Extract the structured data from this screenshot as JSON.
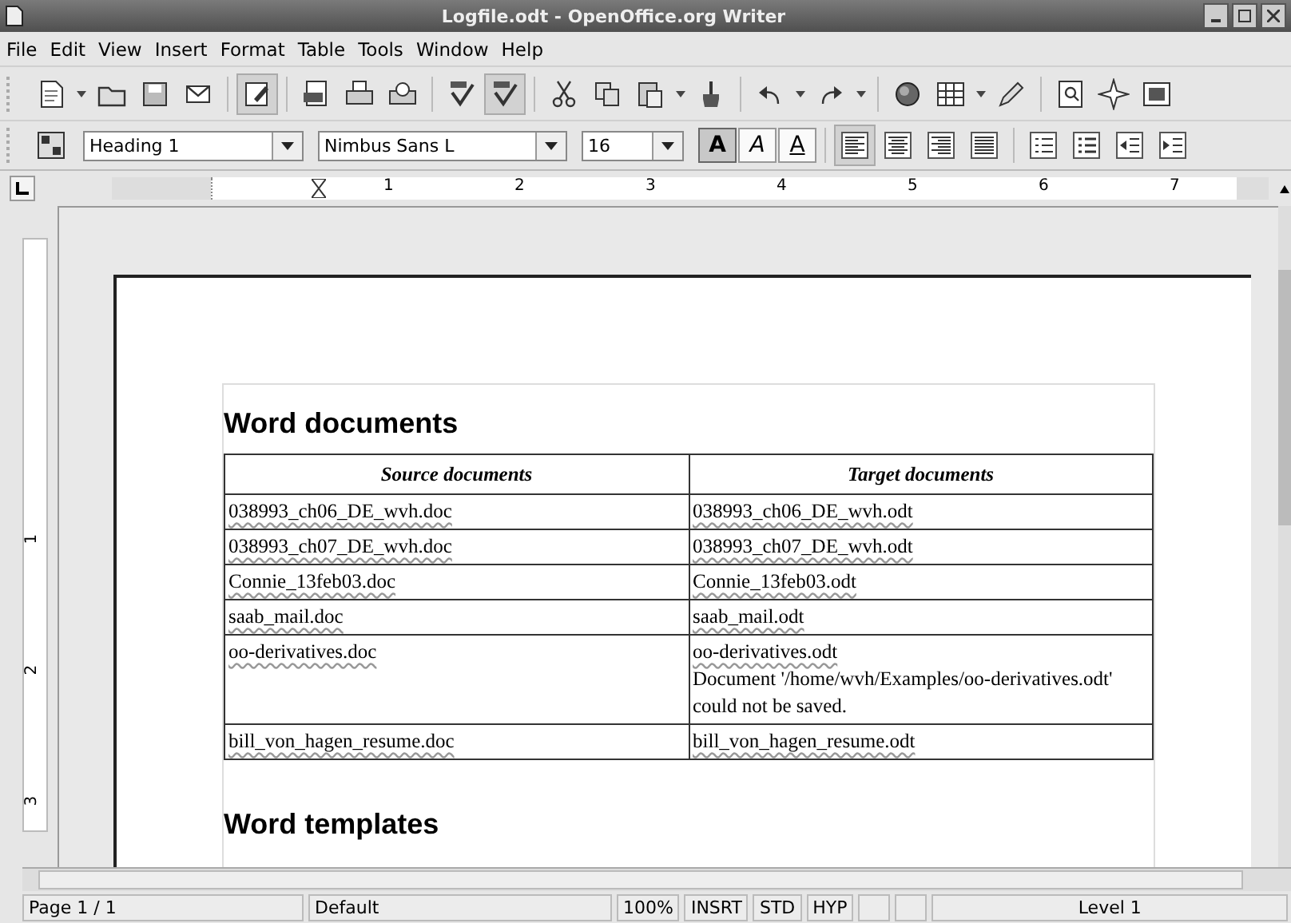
{
  "window": {
    "title": "Logfile.odt - OpenOffice.org Writer"
  },
  "menu": [
    "File",
    "Edit",
    "View",
    "Insert",
    "Format",
    "Table",
    "Tools",
    "Window",
    "Help"
  ],
  "standard_toolbar": [
    {
      "kind": "new",
      "on": false
    },
    {
      "kind": "drop"
    },
    {
      "kind": "open",
      "on": false
    },
    {
      "kind": "save",
      "on": false
    },
    {
      "kind": "mail",
      "on": false
    },
    {
      "kind": "sep"
    },
    {
      "kind": "edit",
      "on": true
    },
    {
      "kind": "sep"
    },
    {
      "kind": "pdf",
      "on": false
    },
    {
      "kind": "print",
      "on": false
    },
    {
      "kind": "preview",
      "on": false
    },
    {
      "kind": "sep"
    },
    {
      "kind": "spell",
      "on": false
    },
    {
      "kind": "spell",
      "on": true
    },
    {
      "kind": "sep"
    },
    {
      "kind": "cut",
      "on": false
    },
    {
      "kind": "copy",
      "on": false
    },
    {
      "kind": "paste",
      "on": false
    },
    {
      "kind": "drop"
    },
    {
      "kind": "brush",
      "on": false
    },
    {
      "kind": "sep"
    },
    {
      "kind": "undo",
      "on": false
    },
    {
      "kind": "drop"
    },
    {
      "kind": "redo",
      "on": false
    },
    {
      "kind": "drop"
    },
    {
      "kind": "sep"
    },
    {
      "kind": "globe",
      "on": false
    },
    {
      "kind": "table",
      "on": false
    },
    {
      "kind": "drop"
    },
    {
      "kind": "draw",
      "on": false
    },
    {
      "kind": "sep"
    },
    {
      "kind": "find",
      "on": false
    },
    {
      "kind": "star",
      "on": false
    },
    {
      "kind": "gallery",
      "on": false
    }
  ],
  "formatting_toolbar": {
    "style": "Heading 1",
    "font": "Nimbus Sans L",
    "size": "16",
    "buttons": [
      {
        "kind": "letter",
        "label": "A",
        "on": true
      },
      {
        "kind": "letter",
        "label": "A",
        "on": false
      },
      {
        "kind": "letter",
        "label": "A",
        "on": false
      },
      {
        "kind": "sep"
      },
      {
        "kind": "left",
        "on": true
      },
      {
        "kind": "center",
        "on": false
      },
      {
        "kind": "right",
        "on": false
      },
      {
        "kind": "justify",
        "on": false
      },
      {
        "kind": "sep"
      },
      {
        "kind": "numbers",
        "on": false
      },
      {
        "kind": "bullets",
        "on": false
      },
      {
        "kind": "outdent",
        "on": false
      },
      {
        "kind": "indent",
        "on": false
      }
    ]
  },
  "ruler": {
    "numbers": [
      "1",
      "2",
      "3",
      "4",
      "5",
      "6",
      "7"
    ]
  },
  "vertical_ruler": {
    "numbers": [
      "1",
      "2",
      "3"
    ]
  },
  "document": {
    "heading": "Word documents",
    "table": {
      "columns": [
        "Source documents",
        "Target documents"
      ],
      "rows": [
        [
          "038993_ch06_DE_wvh.doc",
          "038993_ch06_DE_wvh.odt"
        ],
        [
          "038993_ch07_DE_wvh.doc",
          "038993_ch07_DE_wvh.odt"
        ],
        [
          "Connie_13feb03.doc",
          "Connie_13feb03.odt"
        ],
        [
          "saab_mail.doc",
          "saab_mail.odt"
        ],
        [
          "oo-derivatives.doc",
          "oo-derivatives.odt\nDocument '/home/wvh/Examples/oo-derivatives.odt' could not be saved."
        ],
        [
          "bill_von_hagen_resume.doc",
          "bill_von_hagen_resume.odt"
        ]
      ]
    },
    "heading_2": "Word templates"
  },
  "status_bar": [
    "Page 1 / 1",
    "Default",
    "100%",
    "INSRT",
    "STD",
    "HYP",
    "Level 1"
  ]
}
